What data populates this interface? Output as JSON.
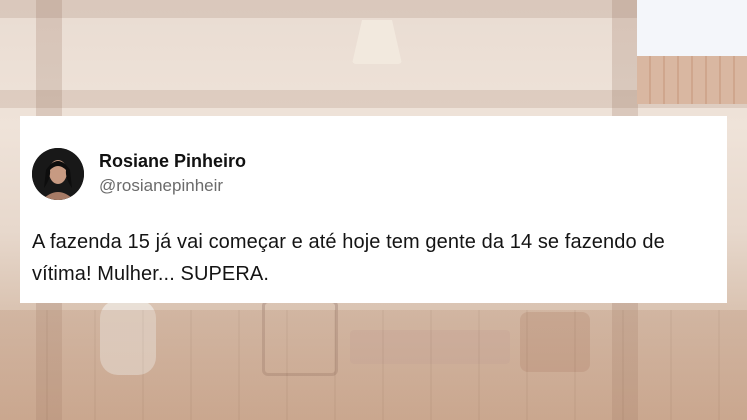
{
  "tweet": {
    "author_name": "Rosiane Pinheiro",
    "author_handle": "@rosianepinheir",
    "text": "A fazenda 15 já vai começar e até hoje tem gente da 14 se fazendo de vítima! Mulher... SUPERA."
  }
}
